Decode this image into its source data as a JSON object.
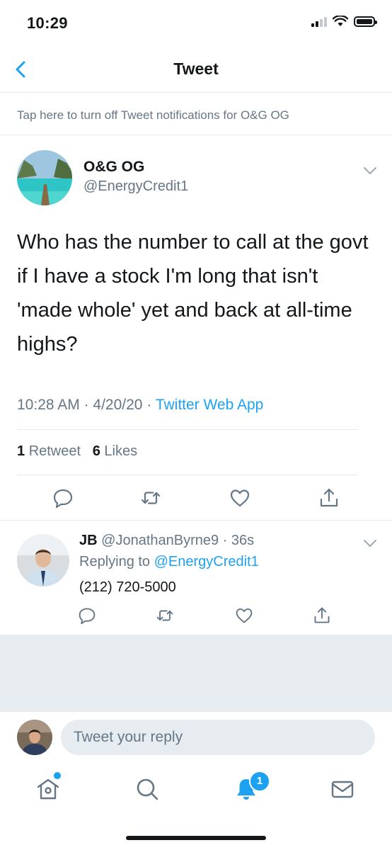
{
  "status": {
    "time": "10:29"
  },
  "nav": {
    "title": "Tweet"
  },
  "notification_banner": "Tap here to turn off Tweet notifications for O&G OG",
  "tweet": {
    "author_name": "O&G OG",
    "author_handle": "@EnergyCredit1",
    "text": "Who has the number to call at the govt if I have a stock I'm long that isn't 'made whole' yet and back at all-time highs?",
    "time": "10:28 AM",
    "date": "4/20/20",
    "source": "Twitter Web App",
    "retweets": "1",
    "retweets_label": "Retweet",
    "likes": "6",
    "likes_label": "Likes"
  },
  "reply": {
    "author_name": "JB",
    "author_handle": "@JonathanByrne9",
    "age": "36s",
    "replying_to_label": "Replying to",
    "replying_to": "@EnergyCredit1",
    "text": "(212) 720-5000"
  },
  "composer": {
    "placeholder": "Tweet your reply"
  },
  "tabbar": {
    "notifications_badge": "1"
  },
  "colors": {
    "accent": "#1da1f2",
    "muted": "#657786",
    "divider": "#e1e8ed"
  },
  "icons": [
    "back-chevron-icon",
    "chevron-down-icon",
    "reply-icon",
    "retweet-icon",
    "like-icon",
    "share-icon",
    "home-icon",
    "search-icon",
    "notifications-bell-icon",
    "messages-icon"
  ]
}
